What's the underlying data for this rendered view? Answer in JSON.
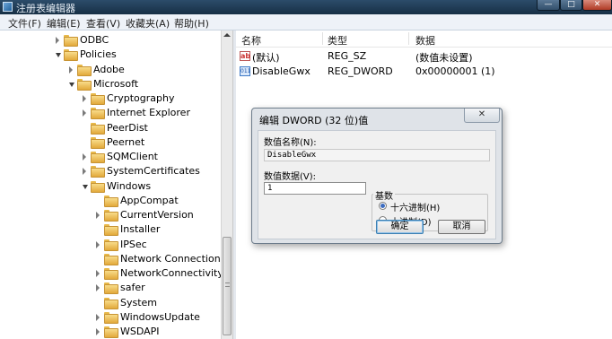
{
  "window": {
    "title": "注册表编辑器"
  },
  "window_buttons": {
    "minimize": "—",
    "maximize": "□",
    "close": "✕"
  },
  "menu": [
    "文件(F)",
    "编辑(E)",
    "查看(V)",
    "收藏夹(A)",
    "帮助(H)"
  ],
  "tree": [
    {
      "label": "ODBC",
      "level": 1,
      "state": "collapsed"
    },
    {
      "label": "Policies",
      "level": 1,
      "state": "expanded"
    },
    {
      "label": "Adobe",
      "level": 2,
      "state": "collapsed"
    },
    {
      "label": "Microsoft",
      "level": 2,
      "state": "expanded"
    },
    {
      "label": "Cryptography",
      "level": 3,
      "state": "collapsed"
    },
    {
      "label": "Internet Explorer",
      "level": 3,
      "state": "collapsed"
    },
    {
      "label": "PeerDist",
      "level": 3,
      "state": "none"
    },
    {
      "label": "Peernet",
      "level": 3,
      "state": "none"
    },
    {
      "label": "SQMClient",
      "level": 3,
      "state": "collapsed"
    },
    {
      "label": "SystemCertificates",
      "level": 3,
      "state": "collapsed"
    },
    {
      "label": "Windows",
      "level": 3,
      "state": "expanded"
    },
    {
      "label": "AppCompat",
      "level": 4,
      "state": "none"
    },
    {
      "label": "CurrentVersion",
      "level": 4,
      "state": "collapsed"
    },
    {
      "label": "Installer",
      "level": 4,
      "state": "none"
    },
    {
      "label": "IPSec",
      "level": 4,
      "state": "collapsed"
    },
    {
      "label": "Network Connections",
      "level": 4,
      "state": "none"
    },
    {
      "label": "NetworkConnectivitySta",
      "level": 4,
      "state": "collapsed"
    },
    {
      "label": "safer",
      "level": 4,
      "state": "collapsed"
    },
    {
      "label": "System",
      "level": 4,
      "state": "none"
    },
    {
      "label": "WindowsUpdate",
      "level": 4,
      "state": "collapsed"
    },
    {
      "label": "WSDAPI",
      "level": 4,
      "state": "collapsed"
    }
  ],
  "list": {
    "columns": [
      "名称",
      "类型",
      "数据"
    ],
    "rows": [
      {
        "icon": "ab",
        "name": "(默认)",
        "type": "REG_SZ",
        "data": "(数值未设置)"
      },
      {
        "icon": "011",
        "name": "DisableGwx",
        "type": "REG_DWORD",
        "data": "0x00000001 (1)"
      }
    ]
  },
  "dialog": {
    "title": "编辑 DWORD (32 位)值",
    "close": "✕",
    "name_label": "数值名称(N):",
    "name_value": "DisableGwx",
    "data_label": "数值数据(V):",
    "data_value": "1",
    "base_label": "基数",
    "radio_hex": "十六进制(H)",
    "radio_dec": "十进制(D)",
    "ok": "确定",
    "cancel": "取消"
  }
}
